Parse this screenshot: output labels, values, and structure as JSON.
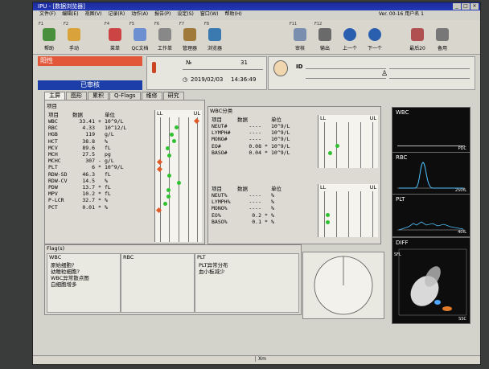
{
  "window": {
    "title": "IPU - [数据浏览器]",
    "version": "Ver. 00-16 用户名 1"
  },
  "menu": [
    "文件(F)",
    "编辑(E)",
    "视图(V)",
    "记录(R)",
    "动作(A)",
    "报告(P)",
    "设定(S)",
    "窗口(W)",
    "帮助(H)"
  ],
  "toolbar": {
    "left": [
      {
        "fk": "F1",
        "label": "帮助"
      },
      {
        "fk": "F2",
        "label": "手动"
      },
      {
        "fk": "F4",
        "label": "菜单"
      },
      {
        "fk": "F5",
        "label": "QC文档"
      },
      {
        "fk": "F6",
        "label": "工作单"
      },
      {
        "fk": "F7",
        "label": "管理器"
      },
      {
        "fk": "F8",
        "label": "浏览器"
      }
    ],
    "right": [
      {
        "fk": "F11",
        "label": "审核"
      },
      {
        "fk": "F12",
        "label": "输出"
      },
      {
        "fk": "",
        "label": "上一个"
      },
      {
        "fk": "",
        "label": "下一个"
      },
      {
        "fk": "",
        "label": "最后20"
      },
      {
        "fk": "",
        "label": "备用"
      }
    ]
  },
  "header": {
    "status": "阳性",
    "audit": "已审核",
    "no_label": "№",
    "no_value": "31",
    "date": "2019/02/03",
    "time": "14:36:49",
    "id_label": "ID"
  },
  "tabs": [
    "主屏",
    "图形",
    "累积",
    "Q-Flags",
    "维修",
    "研究"
  ],
  "main_panel": {
    "title": "项目",
    "cols": [
      "项目",
      "数据",
      "",
      "单位",
      "LL",
      "UL"
    ],
    "rows": [
      {
        "name": "WBC",
        "val": "33.41",
        "flag": "+",
        "unit": "10^9/L",
        "pos": 0.88,
        "mk": "dia"
      },
      {
        "name": "RBC",
        "val": "4.33",
        "flag": "",
        "unit": "10^12/L",
        "pos": 0.45,
        "mk": "dot"
      },
      {
        "name": "HGB",
        "val": "119",
        "flag": "",
        "unit": "g/L",
        "pos": 0.35,
        "mk": "dot"
      },
      {
        "name": "HCT",
        "val": "38.8",
        "flag": "",
        "unit": "%",
        "pos": 0.4,
        "mk": "dot"
      },
      {
        "name": "MCV",
        "val": "89.6",
        "flag": "",
        "unit": "fL",
        "pos": 0.27,
        "mk": "dot"
      },
      {
        "name": "MCH",
        "val": "27.5",
        "flag": "",
        "unit": "pg",
        "pos": 0.3,
        "mk": "dot"
      },
      {
        "name": "MCHC",
        "val": "307",
        "flag": "-",
        "unit": "g/L",
        "pos": 0.1,
        "mk": "dia"
      },
      {
        "name": "PLT",
        "val": "6",
        "flag": "*",
        "unit": "10^9/L",
        "pos": 0.1,
        "mk": "dia"
      },
      {
        "name": "RDW-SD",
        "val": "46.3",
        "flag": "",
        "unit": "fL",
        "pos": 0.3,
        "mk": "dot"
      },
      {
        "name": "RDW-CV",
        "val": "14.5",
        "flag": "",
        "unit": "%",
        "pos": 0.5,
        "mk": "dot"
      },
      {
        "name": "PDW",
        "val": "13.7",
        "flag": "*",
        "unit": "fL",
        "pos": 0.28,
        "mk": "dot"
      },
      {
        "name": "MPV",
        "val": "10.2",
        "flag": "*",
        "unit": "fL",
        "pos": 0.28,
        "mk": "dot"
      },
      {
        "name": "P-LCR",
        "val": "32.7",
        "flag": "*",
        "unit": "%",
        "pos": 0.22,
        "mk": "dot"
      },
      {
        "name": "PCT",
        "val": "0.01",
        "flag": "*",
        "unit": "%",
        "pos": 0.08,
        "mk": "dia"
      }
    ]
  },
  "wbc_panel": {
    "title": "WBC分类",
    "cols": [
      "项目",
      "数据",
      "",
      "单位",
      "LL",
      "UL"
    ],
    "abs_rows": [
      {
        "name": "NEUT#",
        "val": "----",
        "flag": "",
        "unit": "10^9/L",
        "pos": -1,
        "mk": ""
      },
      {
        "name": "LYMPH#",
        "val": "----",
        "flag": "",
        "unit": "10^9/L",
        "pos": -1,
        "mk": ""
      },
      {
        "name": "MONO#",
        "val": "----",
        "flag": "",
        "unit": "10^9/L",
        "pos": -1,
        "mk": ""
      },
      {
        "name": "EO#",
        "val": "0.08",
        "flag": "*",
        "unit": "10^9/L",
        "pos": 0.32,
        "mk": "dot"
      },
      {
        "name": "BASO#",
        "val": "0.04",
        "flag": "*",
        "unit": "10^9/L",
        "pos": 0.2,
        "mk": "dot"
      }
    ],
    "pct_rows": [
      {
        "name": "NEUT%",
        "val": "----",
        "flag": "",
        "unit": "%",
        "pos": -1,
        "mk": ""
      },
      {
        "name": "LYMPH%",
        "val": "----",
        "flag": "",
        "unit": "%",
        "pos": -1,
        "mk": ""
      },
      {
        "name": "MONO%",
        "val": "----",
        "flag": "",
        "unit": "%",
        "pos": -1,
        "mk": ""
      },
      {
        "name": "EO%",
        "val": "0.2",
        "flag": "*",
        "unit": "%",
        "pos": 0.15,
        "mk": "dot"
      },
      {
        "name": "BASO%",
        "val": "0.1",
        "flag": "*",
        "unit": "%",
        "pos": 0.15,
        "mk": "dot"
      }
    ]
  },
  "flags": {
    "title": "Flag(s)",
    "wbc_title": "WBC",
    "rbc_title": "RBC",
    "plt_title": "PLT",
    "wbc_items": [
      "原始细胞?",
      "幼稚粒细胞?",
      "WBC异常散点图",
      "白细胞增多"
    ],
    "plt_items": [
      "PLT异常分布",
      "血小板减少"
    ]
  },
  "graphs": {
    "wbc": {
      "label": "WBC",
      "axis": "PDC"
    },
    "rbc": {
      "label": "RBC",
      "axis": "250fL"
    },
    "plt": {
      "label": "PLT",
      "axis": "40fL"
    },
    "diff": {
      "label": "DIFF",
      "axis": "SSC",
      "yaxis": "SFL"
    }
  },
  "footer": {
    "text": "Xm"
  },
  "colors": {
    "positive": "#e2573a",
    "audited": "#1b3ea8",
    "in_range": "#2fc12f",
    "out_range": "#e05a28"
  }
}
